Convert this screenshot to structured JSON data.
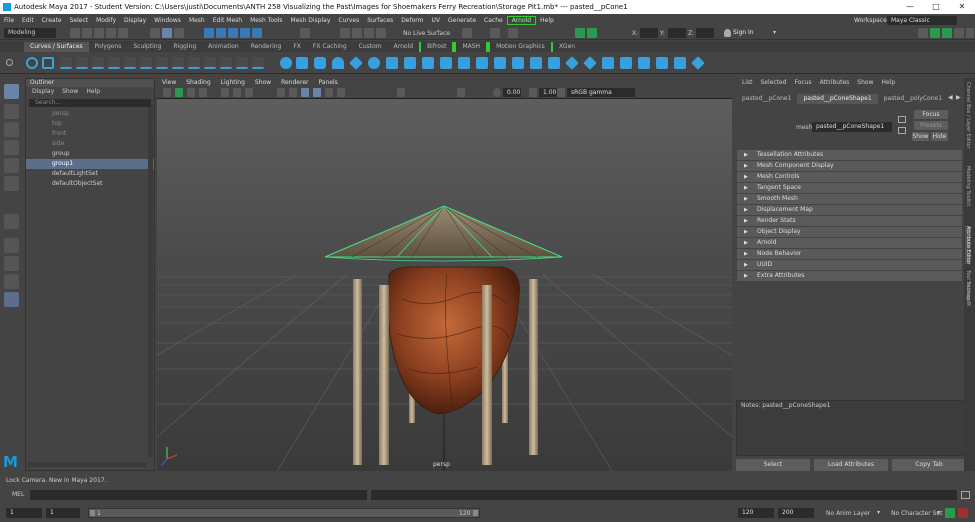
{
  "window": {
    "title": "Autodesk Maya 2017 - Student Version: C:\\Users\\justi\\Documents\\ANTH 258 Visualizing the Past\\Images for Shoemakers Ferry Recreation\\Storage Pit1.mb* --- pasted__pCone1"
  },
  "menubar": {
    "items": [
      "File",
      "Edit",
      "Create",
      "Select",
      "Modify",
      "Display",
      "Windows",
      "Mesh",
      "Edit Mesh",
      "Mesh Tools",
      "Mesh Display",
      "Curves",
      "Surfaces",
      "Deform",
      "UV",
      "Generate",
      "Cache",
      "Arnold",
      "Help"
    ],
    "workspace_label": "Workspace :",
    "workspace_value": "Maya Classic"
  },
  "statusline": {
    "mode": "Modeling",
    "live_surface": "No Live Surface",
    "x_label": "X:",
    "y_label": "Y:",
    "z_label": "Z:",
    "sign_in": "Sign In"
  },
  "shelf": {
    "tabs": [
      "Curves / Surfaces",
      "Polygons",
      "Sculpting",
      "Rigging",
      "Animation",
      "Rendering",
      "FX",
      "FX Caching",
      "Custom",
      "Arnold",
      "Bifrost",
      "MASH",
      "Motion Graphics",
      "XGen"
    ],
    "active_tab": "Curves / Surfaces"
  },
  "outliner": {
    "title": "Outliner",
    "menu": [
      "Display",
      "Show",
      "Help"
    ],
    "search_placeholder": "Search...",
    "items": [
      "persp",
      "top",
      "front",
      "side",
      "group",
      "group1",
      "defaultLightSet",
      "defaultObjectSet"
    ]
  },
  "viewport": {
    "menu": [
      "View",
      "Shading",
      "Lighting",
      "Show",
      "Renderer",
      "Panels"
    ],
    "field_a": "0.00",
    "field_b": "1.00",
    "color_space": "sRGB gamma",
    "camera_label": "persp"
  },
  "attribute_editor": {
    "menu": [
      "List",
      "Selected",
      "Focus",
      "Attributes",
      "Show",
      "Help"
    ],
    "tabs": [
      "pasted__pCone1",
      "pasted__pConeShape1",
      "pasted__polyCone1"
    ],
    "mesh_label": "mesh:",
    "mesh_value": "pasted__pConeShape1",
    "focus_button": "Focus",
    "presets_button": "Presets",
    "show_button": "Show",
    "hide_button": "Hide",
    "sections": [
      "Tessellation Attributes",
      "Mesh Component Display",
      "Mesh Controls",
      "Tangent Space",
      "Smooth Mesh",
      "Displacement Map",
      "Render Stats",
      "Object Display",
      "Arnold",
      "Node Behavior",
      "UUID",
      "Extra Attributes"
    ],
    "notes_label": "Notes:  pasted__pConeShape1",
    "select_button": "Select",
    "load_button": "Load Attributes",
    "copy_button": "Copy Tab"
  },
  "right_tabs": [
    "Channel Box / Layer Editor",
    "Modeling Toolkit",
    "Attribute Editor",
    "Tool Settings",
    "Human IK"
  ],
  "helpline": {
    "text": "Lock Camera. New in Maya 2017."
  },
  "cmdline": {
    "label": "MEL"
  },
  "timeline": {
    "start_field": "1",
    "current_field": "1",
    "range_start": "1",
    "range_end": "120",
    "end_field": "120",
    "anim_end": "200",
    "anim_layer": "No Anim Layer",
    "char_set": "No Character Set"
  },
  "colors": {
    "accent": "#3c9be0",
    "wireframe": "#44dd88",
    "selection": "#5b6e8a"
  }
}
